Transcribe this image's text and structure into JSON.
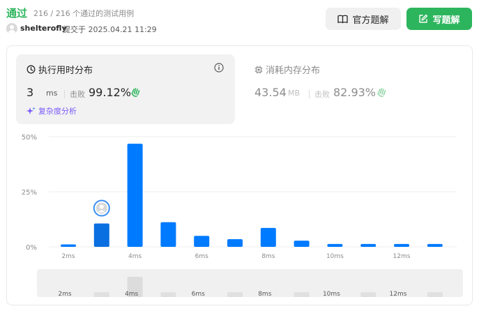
{
  "header": {
    "status": "通过",
    "testcases": "216 / 216 个通过的测试用例",
    "user": "shelterofly",
    "submitted": "提交于 2025.04.21 11:29",
    "editorial_label": "官方题解",
    "solution_label": "写题解"
  },
  "runtime": {
    "title": "执行用时分布",
    "value": "3",
    "unit": "ms",
    "beats_label": "击败",
    "beats": "99.12%",
    "complexity_label": "复杂度分析"
  },
  "memory": {
    "title": "消耗内存分布",
    "value": "43.54",
    "unit": "MB",
    "beats_label": "击败",
    "beats": "82.93%"
  },
  "colors": {
    "accepted": "#2db55d",
    "bar": "#007aff",
    "bar_selected": "#0a6fe0",
    "complexity": "#7c5cfa"
  },
  "chart_data": {
    "type": "bar",
    "x": [
      "2ms",
      "3ms",
      "4ms",
      "5ms",
      "6ms",
      "7ms",
      "8ms",
      "9ms",
      "10ms",
      "11ms",
      "12ms",
      "13ms"
    ],
    "values": [
      1.1,
      10.6,
      46.8,
      11.2,
      5.0,
      3.5,
      8.6,
      2.8,
      1.3,
      1.3,
      1.3,
      1.3
    ],
    "tick_labels": [
      "2ms",
      "4ms",
      "6ms",
      "8ms",
      "10ms",
      "12ms"
    ],
    "y_ticks": [
      "50%",
      "25%",
      "0%"
    ],
    "ylim": [
      0,
      50
    ],
    "selected_index": 1,
    "mini_labels": [
      "2ms",
      "4ms",
      "6ms",
      "8ms",
      "10ms",
      "12ms"
    ]
  }
}
